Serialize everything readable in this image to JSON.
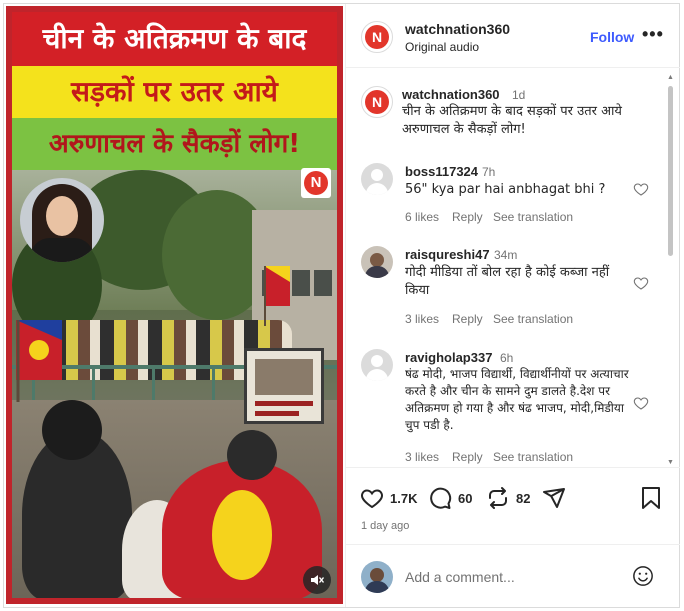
{
  "media": {
    "headline": [
      "चीन के अतिक्रमण के बाद",
      "सड़कों पर उतर आये",
      "अरुणाचल के सैकड़ों लोग!"
    ],
    "logo_letter": "N"
  },
  "post": {
    "username": "watchnation360",
    "subtitle": "Original audio",
    "follow_label": "Follow",
    "more_label": "•••",
    "avatar_letter": "N",
    "caption": {
      "username": "watchnation360",
      "time": "1d",
      "text": "चीन के अतिक्रमण के बाद सड़कों पर उतर आये अरुणाचल के सैकड़ों लोग!"
    }
  },
  "comments": [
    {
      "username": "boss117324",
      "time": "7h",
      "text": "56\" kya par hai anbhagat bhi ?",
      "likes": "6 likes",
      "reply": "Reply",
      "translate": "See translation"
    },
    {
      "username": "raisqureshi47",
      "time": "34m",
      "text": "गोदी मीडिया तों बोल रहा है कोई कब्जा नहीं किया",
      "likes": "3 likes",
      "reply": "Reply",
      "translate": "See translation"
    },
    {
      "username": "ravigholap337",
      "time": "6h",
      "text": "षंढ मोदी, भाजप विद्यार्थी, विद्यार्थीनीयों पर अत्याचार करते है और चीन के सामने दुम डालते है.देश पर अतिक्रमण हो गया है और षंढ भाजप, मोदी,मिडीया चुप पडी है.",
      "likes": "3 likes",
      "reply": "Reply",
      "translate": "See translation"
    }
  ],
  "actions": {
    "like_count": "1.7K",
    "comment_count": "60",
    "repost_count": "82",
    "posted_ago": "1 day ago"
  },
  "add_comment": {
    "placeholder": "Add a comment..."
  },
  "colors": {
    "follow": "#3d5afe",
    "brand_red": "#e2362b",
    "muted_text": "#737373"
  }
}
